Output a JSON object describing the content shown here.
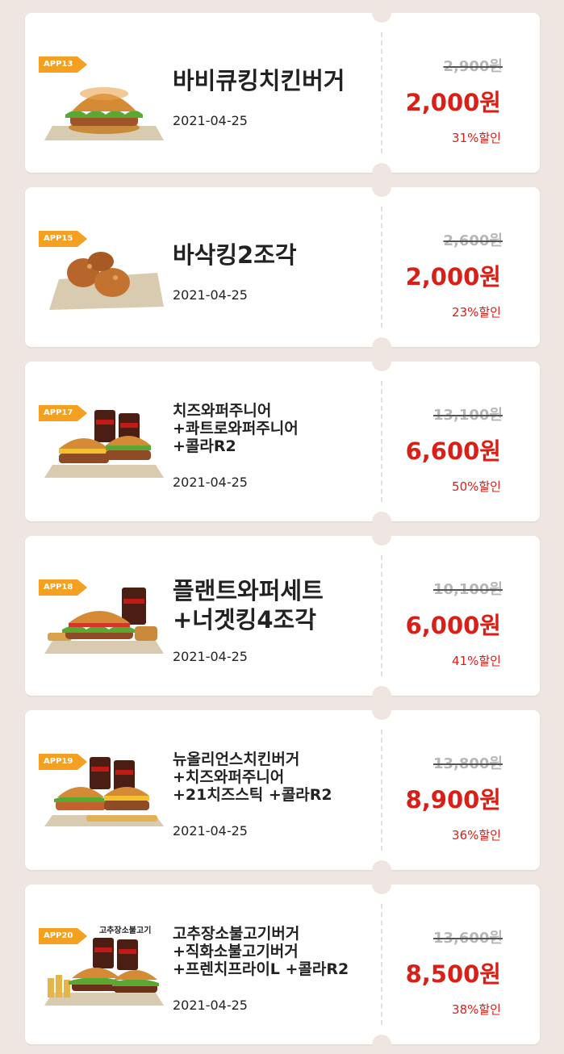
{
  "coupons": [
    {
      "badge": "APP13",
      "title_lines": [
        "바비큐킹치킨버거"
      ],
      "date": "2021-04-25",
      "original_price": "2,900원",
      "sale_price": "2,000원",
      "discount": "31%할인",
      "image": "bbq-chicken-burger"
    },
    {
      "badge": "APP15",
      "title_lines": [
        "바삭킹2조각"
      ],
      "date": "2021-04-25",
      "original_price": "2,600원",
      "sale_price": "2,000원",
      "discount": "23%할인",
      "image": "fried-chicken-pieces"
    },
    {
      "badge": "APP17",
      "title_lines": [
        "치즈와퍼주니어",
        "+콰트로와퍼주니어",
        "+콜라R2"
      ],
      "date": "2021-04-25",
      "original_price": "13,100원",
      "sale_price": "6,600원",
      "discount": "50%할인",
      "image": "two-burgers-two-colas"
    },
    {
      "badge": "APP18",
      "title_lines": [
        "플랜트와퍼세트",
        "+너겟킹4조각"
      ],
      "date": "2021-04-25",
      "original_price": "10,100원",
      "sale_price": "6,000원",
      "discount": "41%할인",
      "image": "burger-set-nuggets"
    },
    {
      "badge": "APP19",
      "title_lines": [
        "뉴올리언스치킨버거",
        "+치즈와퍼주니어",
        "+21치즈스틱 +콜라R2"
      ],
      "date": "2021-04-25",
      "original_price": "13,800원",
      "sale_price": "8,900원",
      "discount": "36%할인",
      "image": "chicken-burger-combo"
    },
    {
      "badge": "APP20",
      "sub_tag": "고추장소불고기",
      "title_lines": [
        "고추장소불고기버거",
        "+직화소불고기버거",
        "+프렌치프라이L +콜라R2"
      ],
      "date": "2021-04-25",
      "original_price": "13,600원",
      "sale_price": "8,500원",
      "discount": "38%할인",
      "image": "bulgogi-burger-combo"
    }
  ],
  "colors": {
    "background": "#efe6e1",
    "badge": "#f5a020",
    "sale": "#d91f17",
    "strike": "#b7b7b7"
  }
}
